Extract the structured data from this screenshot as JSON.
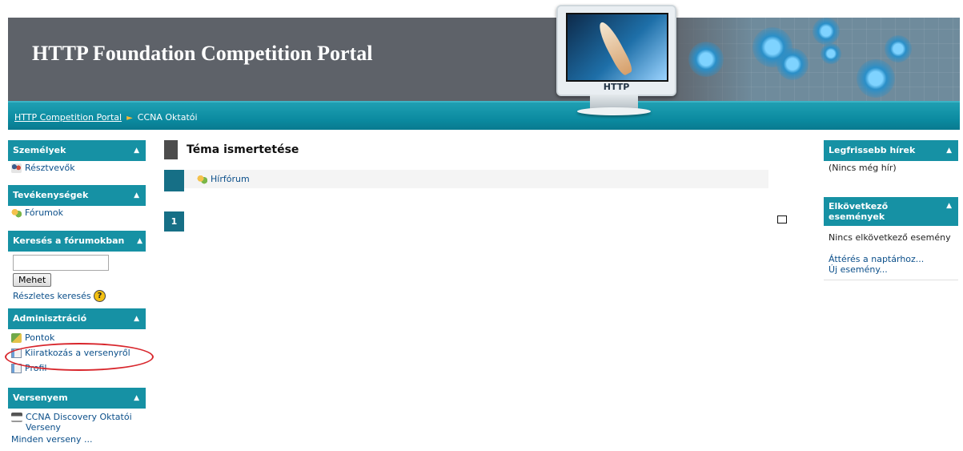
{
  "header": {
    "title": "HTTP Foundation Competition Portal",
    "monitor_brand": "HTTP",
    "breadcrumb": [
      "HTTP Competition Portal",
      "CCNA Oktatói"
    ]
  },
  "left": {
    "people": {
      "title": "Személyek",
      "items": [
        "Résztvevők"
      ]
    },
    "activities": {
      "title": "Tevékenységek",
      "items": [
        "Fórumok"
      ]
    },
    "search": {
      "title": "Keresés a fórumokban",
      "input_value": "",
      "button": "Mehet",
      "advanced": "Részletes keresés",
      "help_glyph": "?"
    },
    "admin": {
      "title": "Adminisztráció",
      "items": [
        "Pontok",
        "Kiiratkozás a versenyről",
        "Profil"
      ]
    },
    "mycourses": {
      "title": "Versenyem",
      "course": "CCNA Discovery Oktatói Verseny",
      "all": "Minden verseny ..."
    }
  },
  "main": {
    "section_title": "Téma ismertetése",
    "forum_link": "Hírfórum",
    "page_number": "1"
  },
  "right": {
    "news": {
      "title": "Legfrissebb hírek",
      "empty": "(Nincs még hír)"
    },
    "events": {
      "title": "Elkövetkező események",
      "empty": "Nincs elkövetkező esemény",
      "calendar_link": "Áttérés a naptárhoz...",
      "new_event": "Új esemény..."
    }
  },
  "icons": {
    "collapse": "caret-up-icon",
    "participants": "people-icon",
    "forums": "forum-icon",
    "grades": "grades-icon",
    "unenrol": "document-icon",
    "profile": "document-icon",
    "course": "course-icon"
  },
  "colors": {
    "header_bg": "#5e6269",
    "navbar": "#0b8aa0",
    "block_header": "#1691a4",
    "section_accent": "#166f86",
    "highlight_oval": "#d8262c"
  }
}
